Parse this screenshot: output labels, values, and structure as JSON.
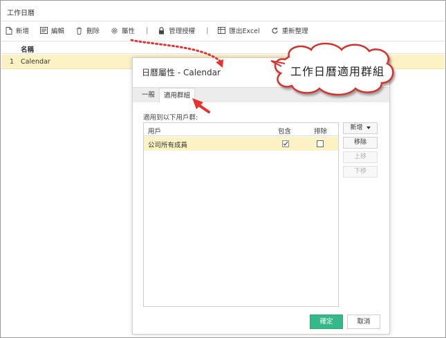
{
  "window": {
    "title": "工作日曆"
  },
  "toolbar": {
    "new_label": "新增",
    "edit_label": "編輯",
    "delete_label": "刪除",
    "properties_label": "屬性",
    "permissions_label": "管理授權",
    "export_label": "匯出Excel",
    "refresh_label": "重新整理"
  },
  "grid": {
    "column_name": "名稱",
    "rows": [
      {
        "num": "1",
        "name": "Calendar"
      }
    ]
  },
  "dialog": {
    "title": "日曆屬性 - Calendar",
    "tabs": [
      {
        "label": "一般"
      },
      {
        "label": "適用群組"
      }
    ],
    "apply_label": "適用到以下用戶群:",
    "list": {
      "col_user": "用戶",
      "col_include": "包含",
      "col_exclude": "排除",
      "rows": [
        {
          "name": "公司所有成員",
          "include": true,
          "exclude": false
        }
      ]
    },
    "side_buttons": {
      "add": "新增",
      "remove": "移除",
      "up": "上移",
      "down": "下移"
    },
    "ok_label": "確定",
    "cancel_label": "取消"
  },
  "callout": {
    "text": "工作日曆適用群組"
  },
  "colors": {
    "highlight_row": "#fdf2c4",
    "ok_button": "#35b98a",
    "annotation_red": "#e8322e"
  }
}
